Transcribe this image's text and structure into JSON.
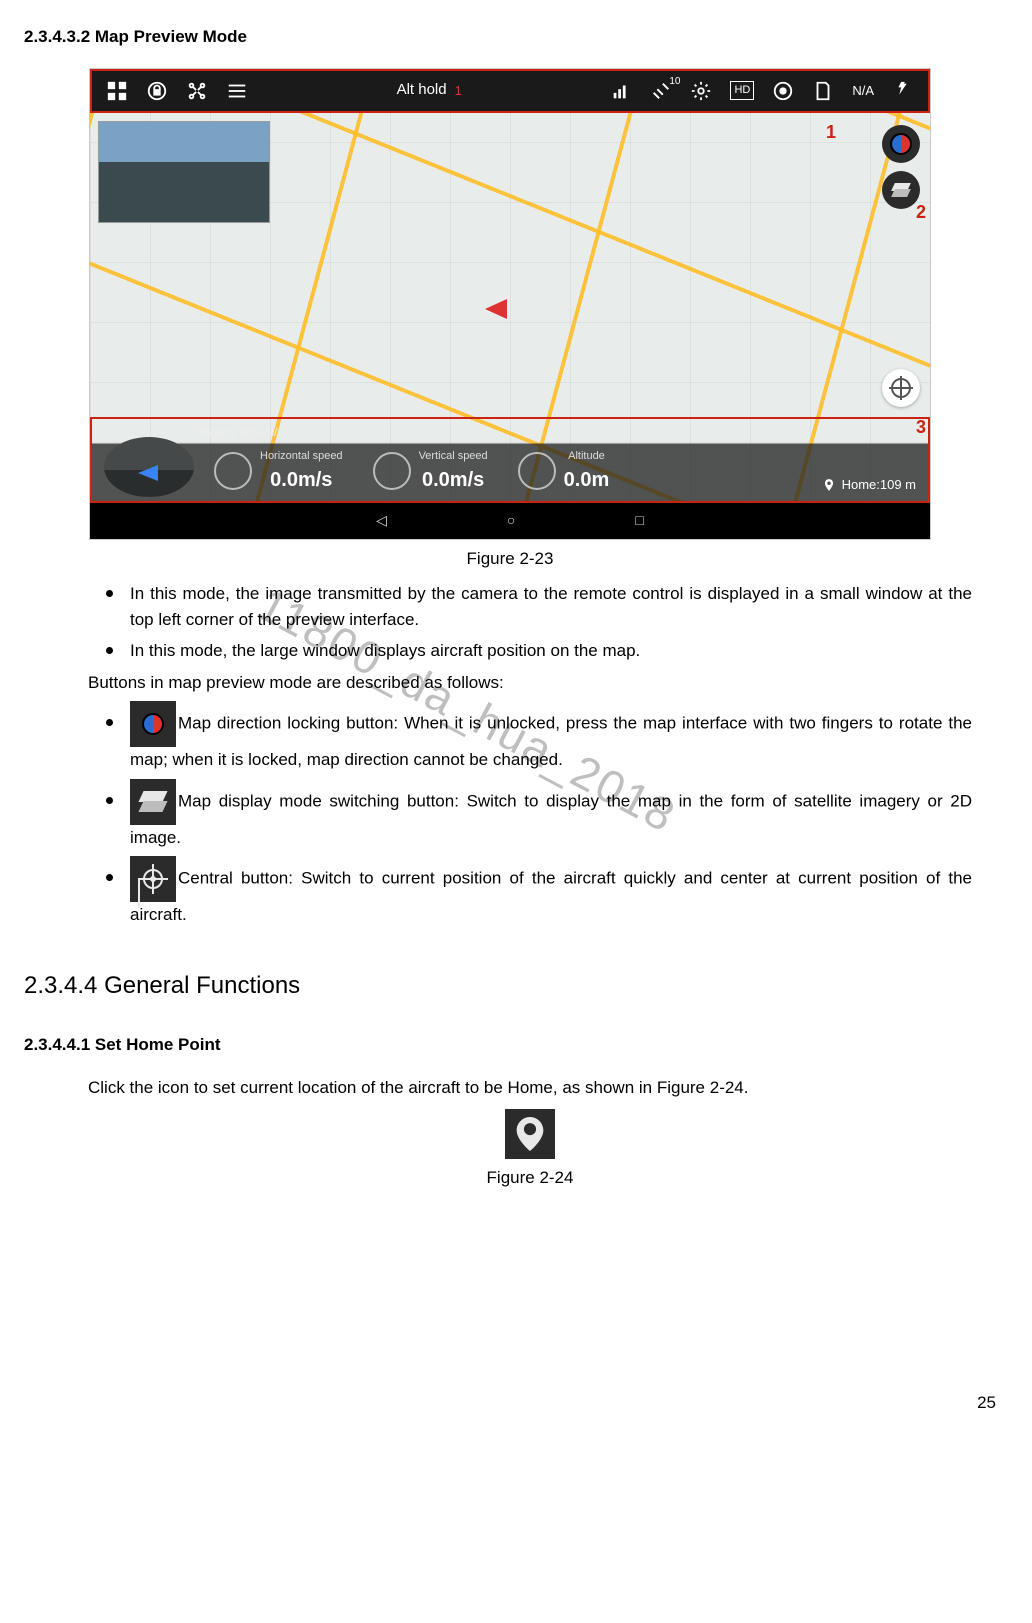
{
  "headings": {
    "h_map_preview": "2.3.4.3.2 Map Preview Mode",
    "h_general_functions": "2.3.4.4 General Functions",
    "h_set_home": "2.3.4.4.1 Set Home Point"
  },
  "figure23": {
    "caption": "Figure 2-23",
    "topbar": {
      "mode_label": "Alt hold",
      "mode_flag": "1",
      "sat_count": "10",
      "hd_label": "HD",
      "sd_label": "N/A"
    },
    "annotations": {
      "a1": "1",
      "a2": "2",
      "a3": "3"
    },
    "battery": "Battery time    N/A",
    "metrics": {
      "h_label": "Horizontal speed",
      "h_val": "0.0m/s",
      "v_label": "Vertical speed",
      "v_val": "0.0m/s",
      "a_label": "Altitude",
      "a_val": "0.0m",
      "home": "Home:109 m"
    },
    "nav": {
      "back": "◁",
      "home": "○",
      "recent": "□"
    }
  },
  "bullets_intro": [
    "In this mode, the image transmitted by the camera to the remote control is displayed in a small window at the top left corner of the preview interface.",
    "In this mode, the large window displays aircraft position on the map."
  ],
  "intro_followup": "Buttons in map preview mode are described as follows:",
  "icon_bullets": {
    "compass": "Map direction locking button: When it is unlocked, press the map interface with two fingers to rotate the map; when it is locked, map direction cannot be changed.",
    "layers": "Map display mode switching button: Switch to display the map in the form of satellite imagery or 2D image.",
    "center": "Central button: Switch to current position of the aircraft quickly and center at current position of the aircraft."
  },
  "set_home_para": "Click the icon to set current location of the aircraft to be Home, as shown in Figure 2-24.",
  "figure24_caption": "Figure 2-24",
  "watermark": "11800_da_hua_2018",
  "page_number": "25"
}
